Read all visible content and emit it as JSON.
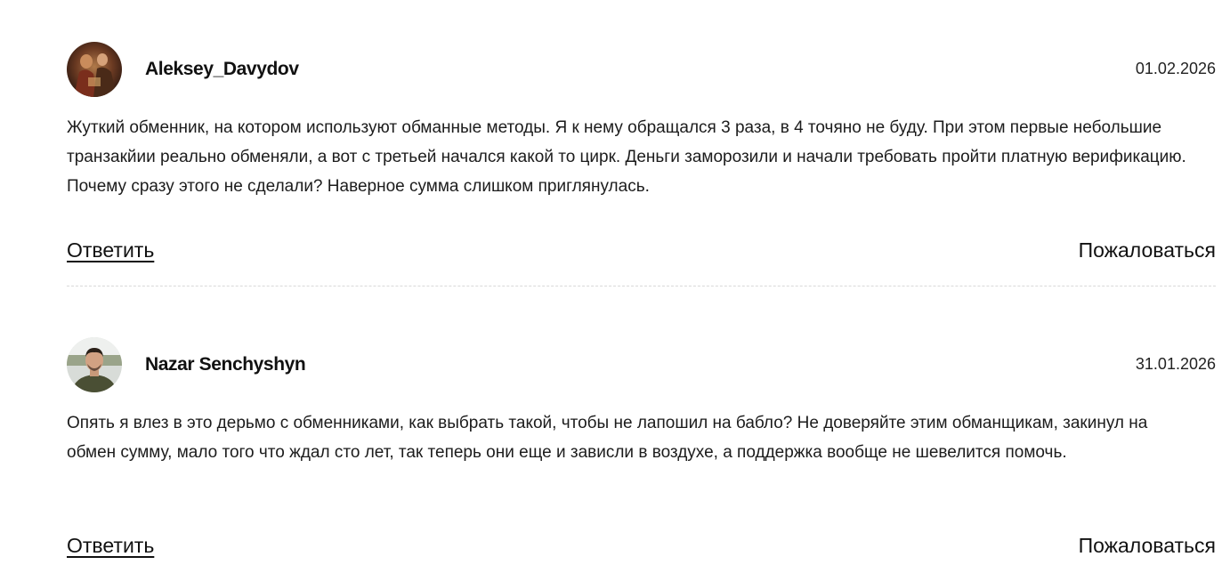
{
  "comments": [
    {
      "author": "Aleksey_Davydov",
      "date": "01.02.2026",
      "text": "Жуткий обменник, на котором используют обманные методы. Я к нему обращался 3 раза, в 4 точяно не буду. При этом первые небольшие транзакйии реально обменяли, а вот с третьей начался какой то цирк. Деньги заморозили и начали требовать пройти платную верификацию. Почему сразу этого не сделали? Наверное сумма слишком приглянулась.",
      "reply_label": "Ответить",
      "report_label": "Пожаловаться",
      "avatar_icon": "painting-avatar"
    },
    {
      "author": "Nazar Senchyshyn",
      "date": "31.01.2026",
      "text": "Опять я влез в это дерьмо с обменниками, как выбрать такой, чтобы не лапошил на бабло? Не доверяйте этим обманщикам, закинул на обмен сумму, мало того что ждал сто лет, так теперь они еще и зависли в воздухе, а поддержка вообще не шевелится помочь.",
      "reply_label": "Ответить",
      "report_label": "Пожаловаться",
      "avatar_icon": "person-photo-avatar"
    }
  ]
}
